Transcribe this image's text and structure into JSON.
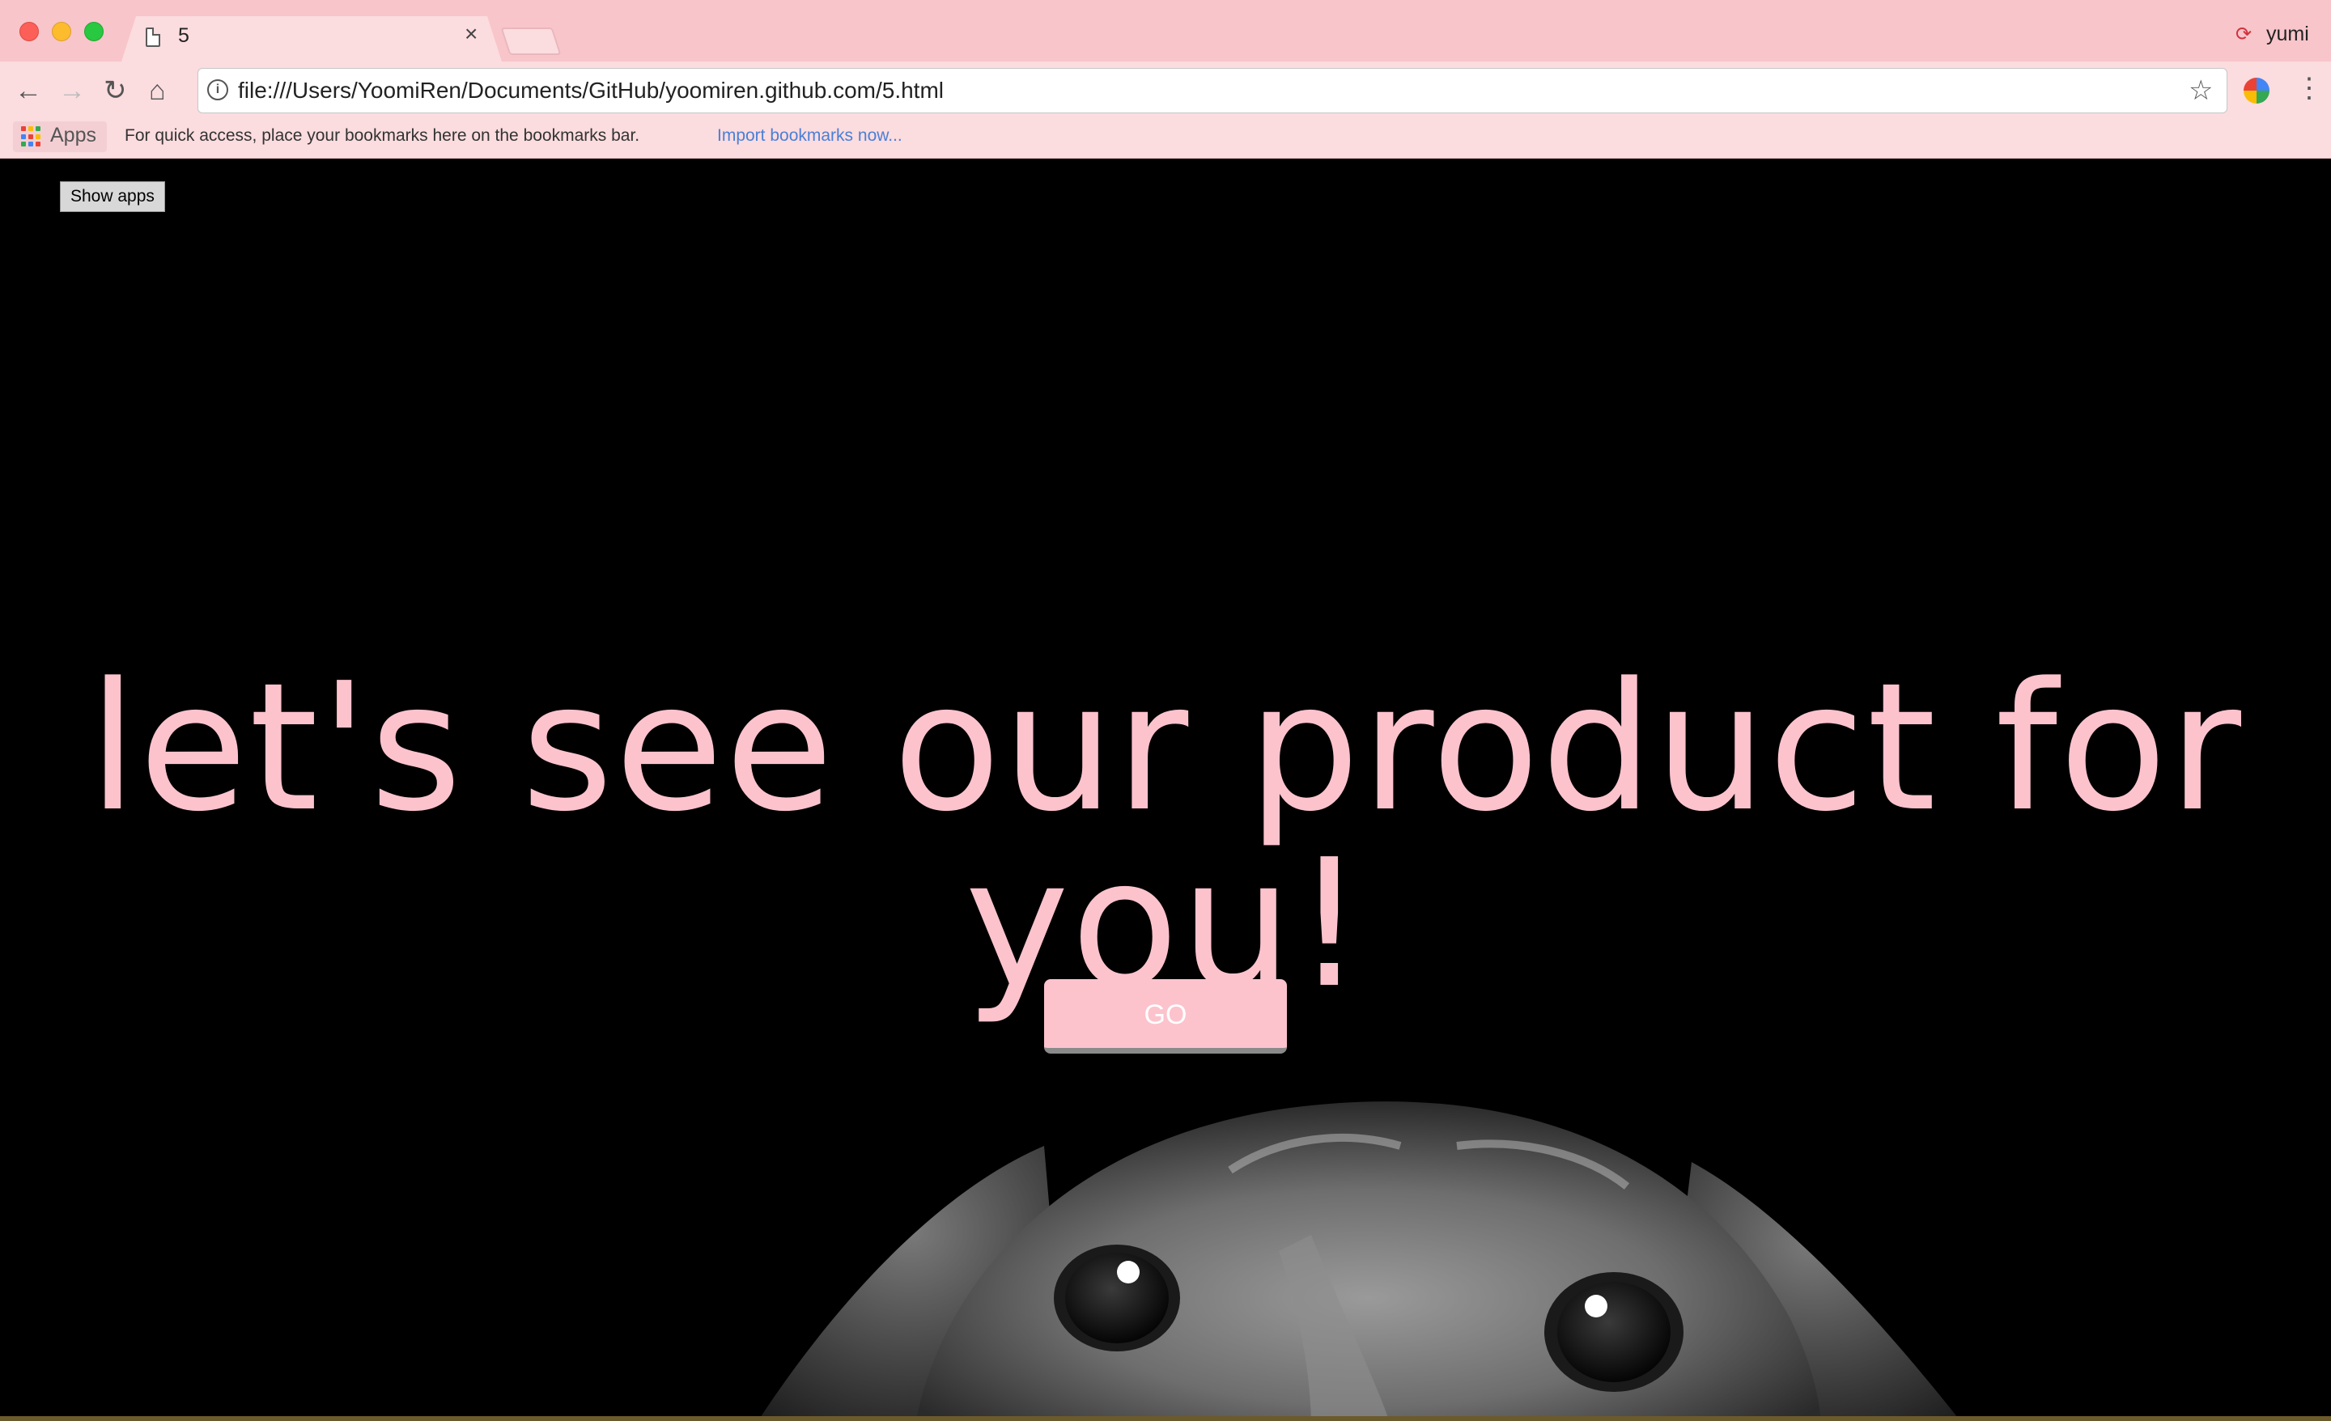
{
  "browser": {
    "tab": {
      "title": "5",
      "close_glyph": "×"
    },
    "profile": {
      "name": "yumi",
      "icon": "sync-error-icon"
    },
    "toolbar": {
      "back_glyph": "←",
      "forward_glyph": "→",
      "reload_glyph": "↻",
      "home_glyph": "⌂",
      "info_glyph": "i",
      "url": "file:///Users/YoomiRen/Documents/GitHub/yoomiren.github.com/5.html",
      "star_glyph": "☆",
      "menu_glyph": "⋮"
    },
    "bookmarks_bar": {
      "apps_label": "Apps",
      "message": "For quick access, place your bookmarks here on the bookmarks bar.",
      "import_link": "Import bookmarks now..."
    }
  },
  "page": {
    "show_apps_label": "Show apps",
    "headline": "let's see our product for you!",
    "go_label": "GO"
  },
  "colors": {
    "accent_pink": "#fcc3cd",
    "chrome_pink": "#f7c5ca",
    "background": "#000000"
  }
}
